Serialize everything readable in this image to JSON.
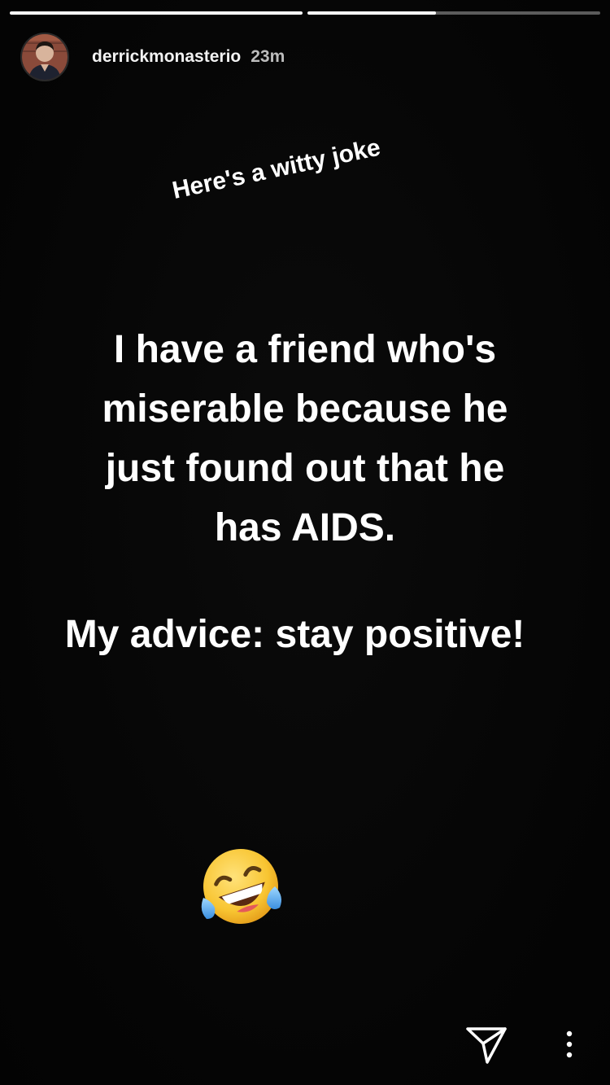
{
  "progress": {
    "segments": [
      1.0,
      0.44
    ]
  },
  "header": {
    "username": "derrickmonasterio",
    "time": "23m"
  },
  "caption": "Here's a witty joke",
  "message": {
    "lines": [
      "I have a friend who's",
      "miserable because he",
      "just found out that he",
      "has AIDS."
    ],
    "punchline": "My advice: stay positive!"
  },
  "sticker": {
    "emoji": "face-with-tears-of-joy"
  },
  "actions": {
    "send_icon": "paper-plane-icon",
    "more_icon": "vertical-ellipsis-icon"
  },
  "colors": {
    "background": "#050505",
    "text": "#ffffff",
    "progress_track": "#8a8a8a",
    "progress_fill": "#ffffff"
  }
}
